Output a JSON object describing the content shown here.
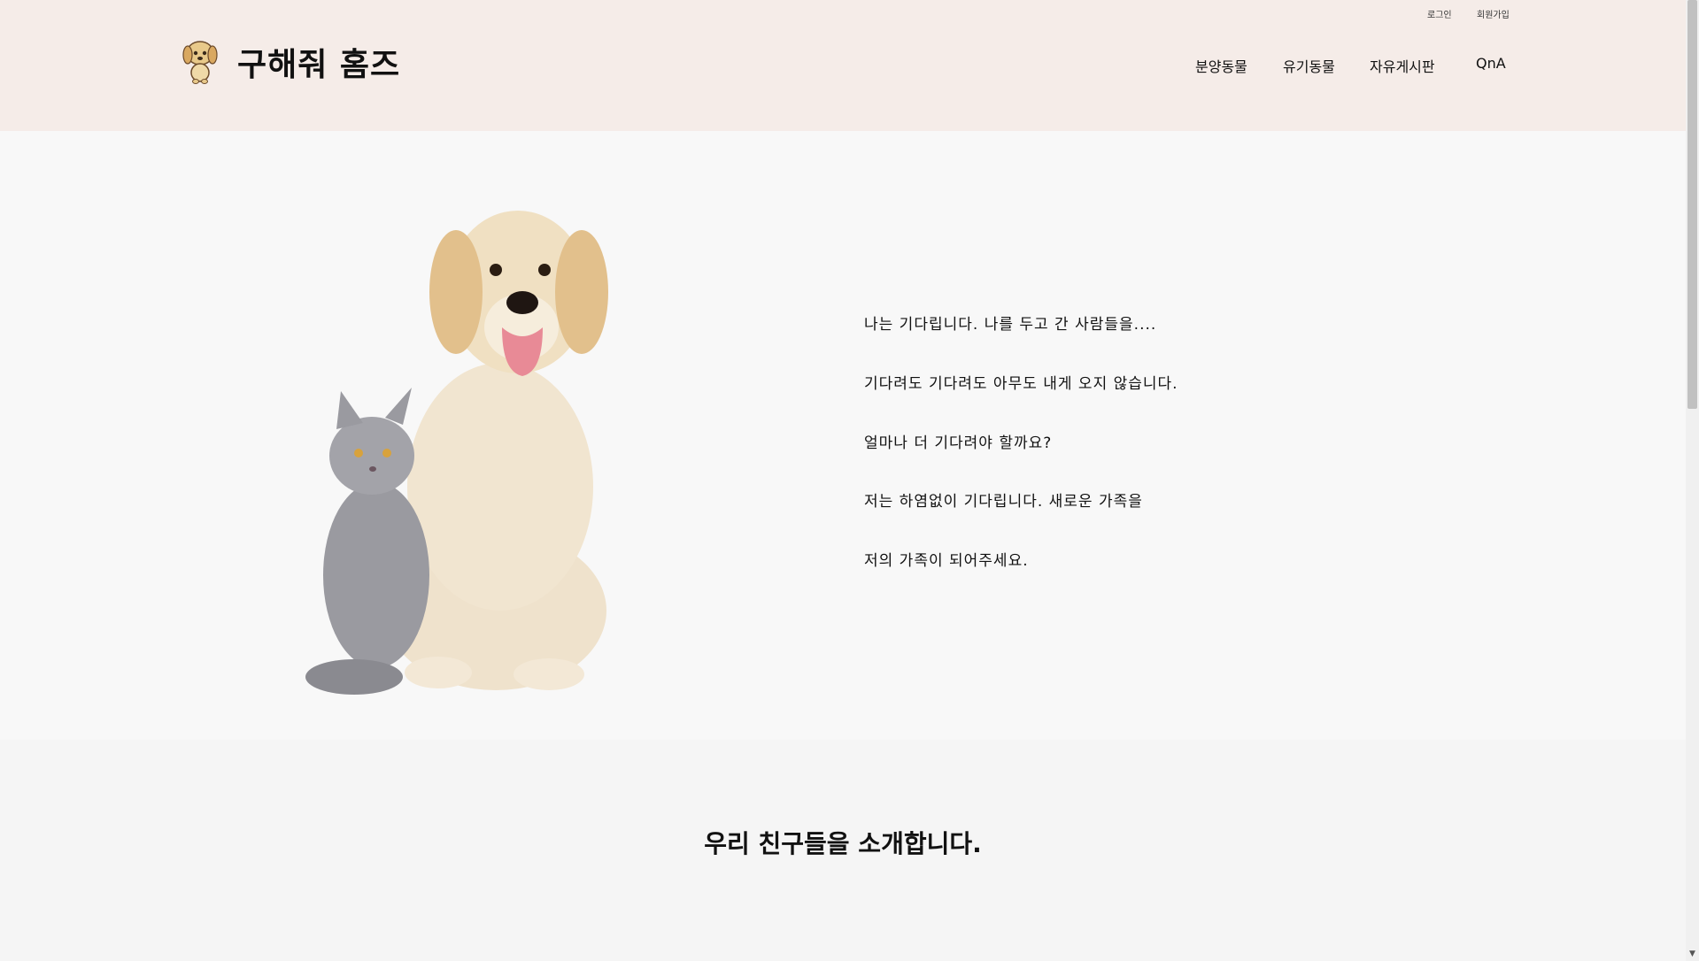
{
  "header": {
    "site_title": "구해줘 홈즈",
    "util_links": {
      "login": "로그인",
      "signup": "회원가입"
    },
    "nav": [
      "분양동물",
      "유기동물",
      "자유게시판",
      "QnA"
    ]
  },
  "hero": {
    "lines": [
      "나는 기다립니다. 나를 두고 간 사람들을....",
      "기다려도 기다려도 아무도 내게 오지 않습니다.",
      "얼마나 더 기다려야 할까요?",
      "저는 하염없이 기다립니다. 새로운 가족을",
      "저의 가족이 되어주세요."
    ]
  },
  "intro": {
    "title": "우리 친구들을 소개합니다."
  },
  "colors": {
    "header_bg": "#f5ece8",
    "hero_bg": "#f8f8f8",
    "section_bg": "#f5f5f5"
  }
}
